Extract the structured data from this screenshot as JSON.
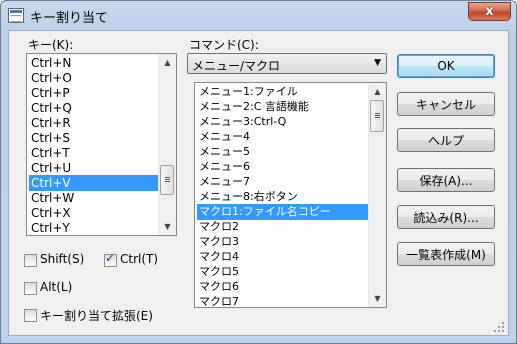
{
  "window": {
    "title": "キー割り当て",
    "close_glyph": "x"
  },
  "key_list": {
    "label": "キー(K):",
    "items": [
      "Ctrl+N",
      "Ctrl+O",
      "Ctrl+P",
      "Ctrl+Q",
      "Ctrl+R",
      "Ctrl+S",
      "Ctrl+T",
      "Ctrl+U",
      "Ctrl+V",
      "Ctrl+W",
      "Ctrl+X",
      "Ctrl+Y"
    ],
    "selected": "Ctrl+V"
  },
  "command": {
    "label": "コマンド(C):",
    "combo_value": "メニュー/マクロ",
    "items": [
      "メニュー1:ファイル",
      "メニュー2:C 言語機能",
      "メニュー3:Ctrl-Q",
      "メニュー4",
      "メニュー5",
      "メニュー6",
      "メニュー7",
      "メニュー8:右ボタン",
      "マクロ1:ファイル名コピー",
      "マクロ2",
      "マクロ3",
      "マクロ4",
      "マクロ5",
      "マクロ6",
      "マクロ7"
    ],
    "selected": "マクロ1:ファイル名コピー"
  },
  "checkboxes": {
    "shift": {
      "label": "Shift(S)",
      "checked": false
    },
    "ctrl": {
      "label": "Ctrl(T)",
      "checked": true
    },
    "alt": {
      "label": "Alt(L)",
      "checked": false
    },
    "extend": {
      "label": "キー割り当て拡張(E)",
      "checked": false
    }
  },
  "buttons": {
    "ok": "OK",
    "cancel": "キャンセル",
    "help": "ヘルプ",
    "save": "保存(A)...",
    "load": "読込み(R)...",
    "list": "一覧表作成(M)"
  },
  "colors": {
    "selection": "#3399ff",
    "frame": "#bcd0e8"
  },
  "icons": {
    "close": "close-icon",
    "app": "keyboard-app-icon"
  }
}
